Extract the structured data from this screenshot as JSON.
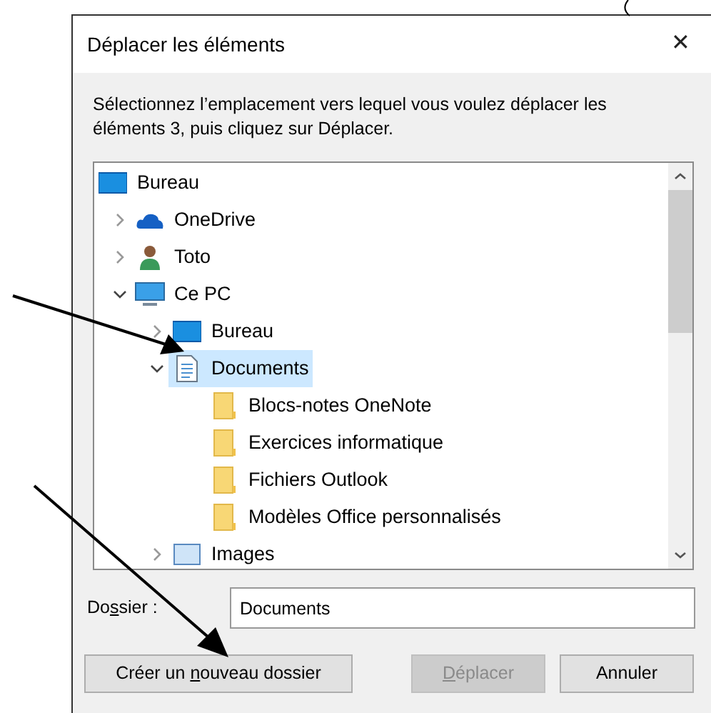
{
  "window": {
    "title": "Déplacer les éléments",
    "close": "✕"
  },
  "instruction": "Sélectionnez l’emplacement vers lequel vous voulez déplacer les éléments 3, puis cliquez sur Déplacer.",
  "tree": [
    {
      "label": "Bureau",
      "kind": "desktop",
      "selected": false,
      "children": [
        {
          "label": "OneDrive",
          "kind": "cloud",
          "expanded": false,
          "selected": false
        },
        {
          "label": "Toto",
          "kind": "user",
          "expanded": false,
          "selected": false
        },
        {
          "label": "Ce PC",
          "kind": "computer",
          "expanded": true,
          "selected": false,
          "children": [
            {
              "label": "Bureau",
              "kind": "desktop",
              "expanded": false,
              "selected": false
            },
            {
              "label": "Documents",
              "kind": "documents",
              "expanded": true,
              "selected": true,
              "children": [
                {
                  "label": "Blocs-notes OneNote",
                  "kind": "folder",
                  "selected": false
                },
                {
                  "label": "Exercices informatique",
                  "kind": "folder",
                  "selected": false
                },
                {
                  "label": "Fichiers Outlook",
                  "kind": "folder",
                  "selected": false
                },
                {
                  "label": "Modèles Office personnalisés",
                  "kind": "folder",
                  "selected": false
                }
              ]
            },
            {
              "label": "Images",
              "kind": "pictures",
              "expanded": false,
              "selected": false
            }
          ]
        }
      ]
    }
  ],
  "folder_field": {
    "label_parts": {
      "before": "Do",
      "key": "s",
      "after": "sier :"
    },
    "value": "Documents"
  },
  "buttons": [
    {
      "label_parts": {
        "before": "Créer un ",
        "key": "n",
        "after": "ouveau dossier"
      },
      "disabled": false
    },
    {
      "label_parts": {
        "key": "D",
        "after": "éplacer"
      },
      "disabled": true
    },
    {
      "label_parts": {
        "before": "Annuler"
      },
      "disabled": false
    }
  ]
}
